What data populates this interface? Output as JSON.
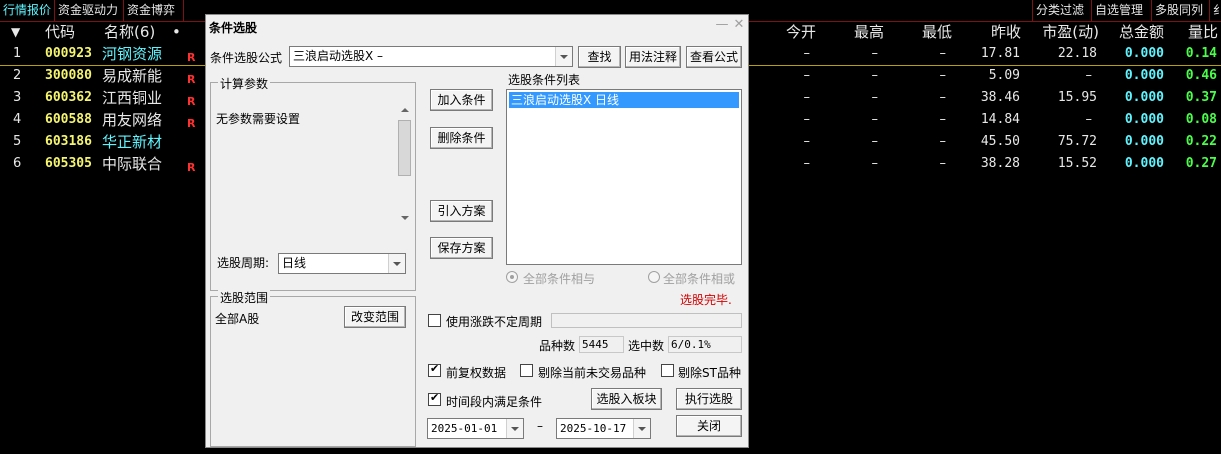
{
  "top_tabs": [
    {
      "label": "行情报价",
      "active": true
    },
    {
      "label": "资金驱动力",
      "active": false
    },
    {
      "label": "资金博弈",
      "active": false
    },
    {
      "label": "分类过滤",
      "active": false
    },
    {
      "label": "自选管理",
      "active": false
    },
    {
      "label": "多股同列",
      "active": false
    },
    {
      "label": "纟",
      "active": false
    }
  ],
  "grid": {
    "columns": {
      "sort_arrow": "▼",
      "code": "代码",
      "name": "名称(6)",
      "dot": "•",
      "open": "今开",
      "high": "最高",
      "low": "最低",
      "prev_close": "昨收",
      "pe": "市盈(动)",
      "amount": "总金额",
      "vol_ratio": "量比"
    },
    "rows": [
      {
        "idx": "1",
        "code": "000923",
        "name": "河钢资源",
        "name_color": "cyan",
        "tag": "R",
        "open": "–",
        "high": "–",
        "low": "–",
        "prev_close": "17.81",
        "pe": "22.18",
        "amount": "0.000",
        "vol_ratio": "0.14"
      },
      {
        "idx": "2",
        "code": "300080",
        "name": "易成新能",
        "name_color": "white",
        "tag": "R",
        "open": "–",
        "high": "–",
        "low": "–",
        "prev_close": "5.09",
        "pe": "–",
        "amount": "0.000",
        "vol_ratio": "0.46"
      },
      {
        "idx": "3",
        "code": "600362",
        "name": "江西铜业",
        "name_color": "white",
        "tag": "R",
        "open": "–",
        "high": "–",
        "low": "–",
        "prev_close": "38.46",
        "pe": "15.95",
        "amount": "0.000",
        "vol_ratio": "0.37"
      },
      {
        "idx": "4",
        "code": "600588",
        "name": "用友网络",
        "name_color": "white",
        "tag": "R",
        "open": "–",
        "high": "–",
        "low": "–",
        "prev_close": "14.84",
        "pe": "–",
        "amount": "0.000",
        "vol_ratio": "0.08"
      },
      {
        "idx": "5",
        "code": "603186",
        "name": "华正新材",
        "name_color": "cyan",
        "tag": "",
        "open": "–",
        "high": "–",
        "low": "–",
        "prev_close": "45.50",
        "pe": "75.72",
        "amount": "0.000",
        "vol_ratio": "0.22"
      },
      {
        "idx": "6",
        "code": "605305",
        "name": "中际联合",
        "name_color": "white",
        "tag": "R",
        "open": "–",
        "high": "–",
        "low": "–",
        "prev_close": "38.28",
        "pe": "15.52",
        "amount": "0.000",
        "vol_ratio": "0.27"
      }
    ]
  },
  "dialog": {
    "title": "条件选股",
    "minimize_glyph": "—",
    "close_glyph": "✕",
    "formula_label": "条件选股公式",
    "formula_value": "三浪启动选股X  –",
    "find_button": "查找",
    "usage_button": "用法注释",
    "view_formula_button": "查看公式",
    "params_group": "计算参数",
    "params_text": "无参数需要设置",
    "period_label": "选股周期:",
    "period_value": "日线",
    "scope_group": "选股范围",
    "scope_value": "全部A股",
    "change_scope_button": "改变范围",
    "add_condition_button": "加入条件",
    "delete_condition_button": "删除条件",
    "import_plan_button": "引入方案",
    "save_plan_button": "保存方案",
    "condition_list_label": "选股条件列表",
    "conditions": [
      "三浪启动选股X  日线"
    ],
    "radio_and": "全部条件相与",
    "radio_or": "全部条件相或",
    "status": "选股完毕.",
    "status_color": "#d40000",
    "variable_period_label": "使用涨跌不定周期",
    "variable_period_checked": false,
    "count_label": "品种数",
    "count_value": "5445",
    "selected_label": "选中数",
    "selected_value": "6/0.1%",
    "forward_adjust_label": "前复权数据",
    "forward_adjust_checked": true,
    "exclude_untraded_label": "剔除当前未交易品种",
    "exclude_untraded_checked": false,
    "exclude_st_label": "剔除ST品种",
    "exclude_st_checked": false,
    "time_range_label": "时间段内满足条件",
    "time_range_checked": true,
    "to_block_button": "选股入板块",
    "run_button": "执行选股",
    "start_date": "2025-01-01",
    "date_separator": "–",
    "end_date": "2025-10-17",
    "close_button": "关闭"
  },
  "colors": {
    "background": "#000000",
    "grid_line": "#7a1414",
    "code": "#f5f56e",
    "cyan": "#5ff5ff",
    "ratio": "#49ff49",
    "tag": "#ff3030",
    "list_selection": "#3399ff"
  }
}
